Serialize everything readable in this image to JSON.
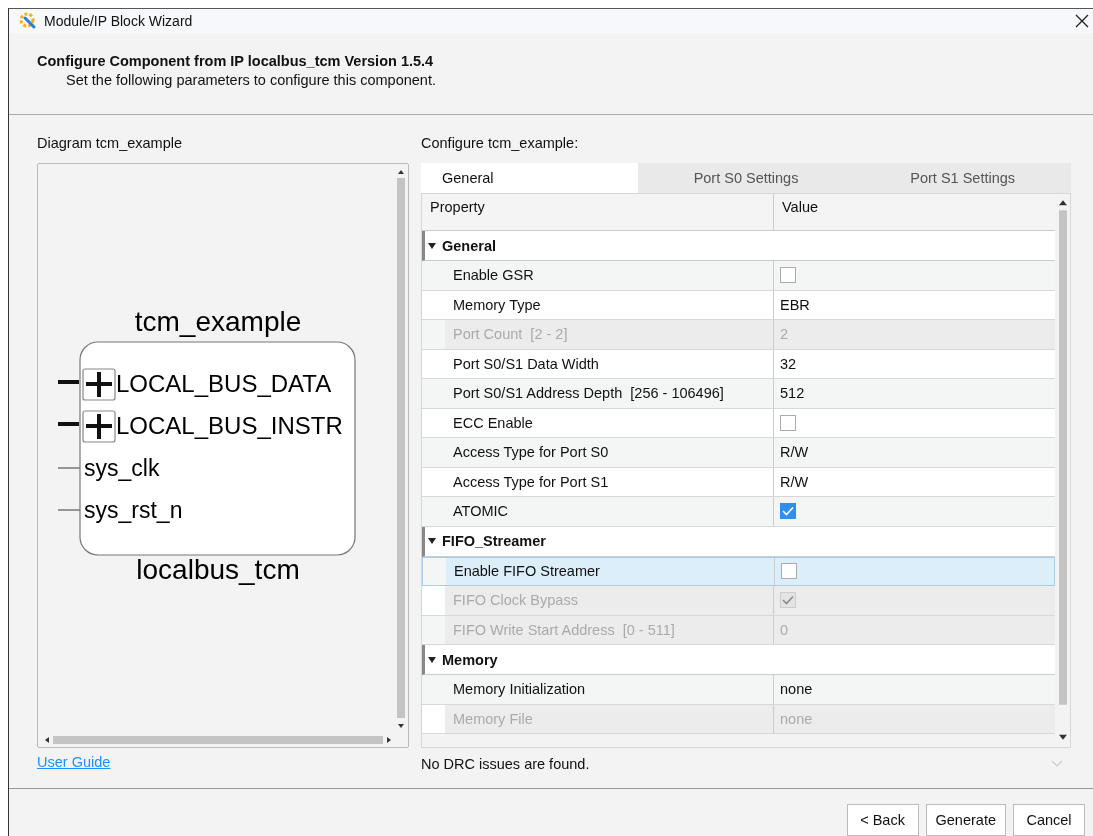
{
  "window": {
    "title": "Module/IP Block Wizard"
  },
  "header": {
    "title": "Configure Component from IP localbus_tcm Version 1.5.4",
    "subtitle": "Set the following parameters to configure this component."
  },
  "diagram": {
    "label": "Diagram tcm_example",
    "instance": "tcm_example",
    "module": "localbus_tcm",
    "ports": [
      {
        "name": "LOCAL_BUS_DATA",
        "kind": "bus"
      },
      {
        "name": "LOCAL_BUS_INSTR",
        "kind": "bus"
      },
      {
        "name": "sys_clk",
        "kind": "wire"
      },
      {
        "name": "sys_rst_n",
        "kind": "wire"
      }
    ]
  },
  "user_guide": "User Guide",
  "config": {
    "label": "Configure tcm_example:",
    "tabs": [
      {
        "label": "General",
        "selected": true
      },
      {
        "label": "Port S0 Settings",
        "selected": false
      },
      {
        "label": "Port S1 Settings",
        "selected": false
      }
    ],
    "columns": [
      "Property",
      "Value"
    ],
    "groups": [
      {
        "name": "General",
        "expanded": true,
        "rows": [
          {
            "property": "Enable GSR",
            "kind": "checkbox",
            "checked": false,
            "disabled": false,
            "selected": false
          },
          {
            "property": "Memory Type",
            "kind": "text",
            "value": "EBR",
            "disabled": false,
            "selected": false
          },
          {
            "property": "Port Count  [2 - 2]",
            "kind": "text",
            "value": "2",
            "disabled": true,
            "selected": false
          },
          {
            "property": "Port S0/S1 Data Width",
            "kind": "text",
            "value": "32",
            "disabled": false,
            "selected": false
          },
          {
            "property": "Port S0/S1 Address Depth  [256 - 106496]",
            "kind": "text",
            "value": "512",
            "disabled": false,
            "selected": false
          },
          {
            "property": "ECC Enable",
            "kind": "checkbox",
            "checked": false,
            "disabled": false,
            "selected": false
          },
          {
            "property": "Access Type for Port S0",
            "kind": "text",
            "value": "R/W",
            "disabled": false,
            "selected": false
          },
          {
            "property": "Access Type for Port S1",
            "kind": "text",
            "value": "R/W",
            "disabled": false,
            "selected": false
          },
          {
            "property": "ATOMIC",
            "kind": "checkbox",
            "checked": true,
            "disabled": false,
            "selected": false
          }
        ]
      },
      {
        "name": "FIFO_Streamer",
        "expanded": true,
        "rows": [
          {
            "property": "Enable FIFO Streamer",
            "kind": "checkbox",
            "checked": false,
            "disabled": false,
            "selected": true
          },
          {
            "property": "FIFO Clock Bypass",
            "kind": "checkbox",
            "checked": true,
            "disabled": true,
            "selected": false
          },
          {
            "property": "FIFO Write Start Address  [0 - 511]",
            "kind": "text",
            "value": "0",
            "disabled": true,
            "selected": false
          }
        ]
      },
      {
        "name": "Memory",
        "expanded": true,
        "rows": [
          {
            "property": "Memory Initialization",
            "kind": "text",
            "value": "none",
            "disabled": false,
            "selected": false
          },
          {
            "property": "Memory File",
            "kind": "text",
            "value": "none",
            "disabled": true,
            "selected": false
          }
        ]
      }
    ]
  },
  "status": "No DRC issues are found.",
  "buttons": [
    {
      "label": "< Back"
    },
    {
      "label": "Generate"
    },
    {
      "label": "Cancel"
    }
  ]
}
